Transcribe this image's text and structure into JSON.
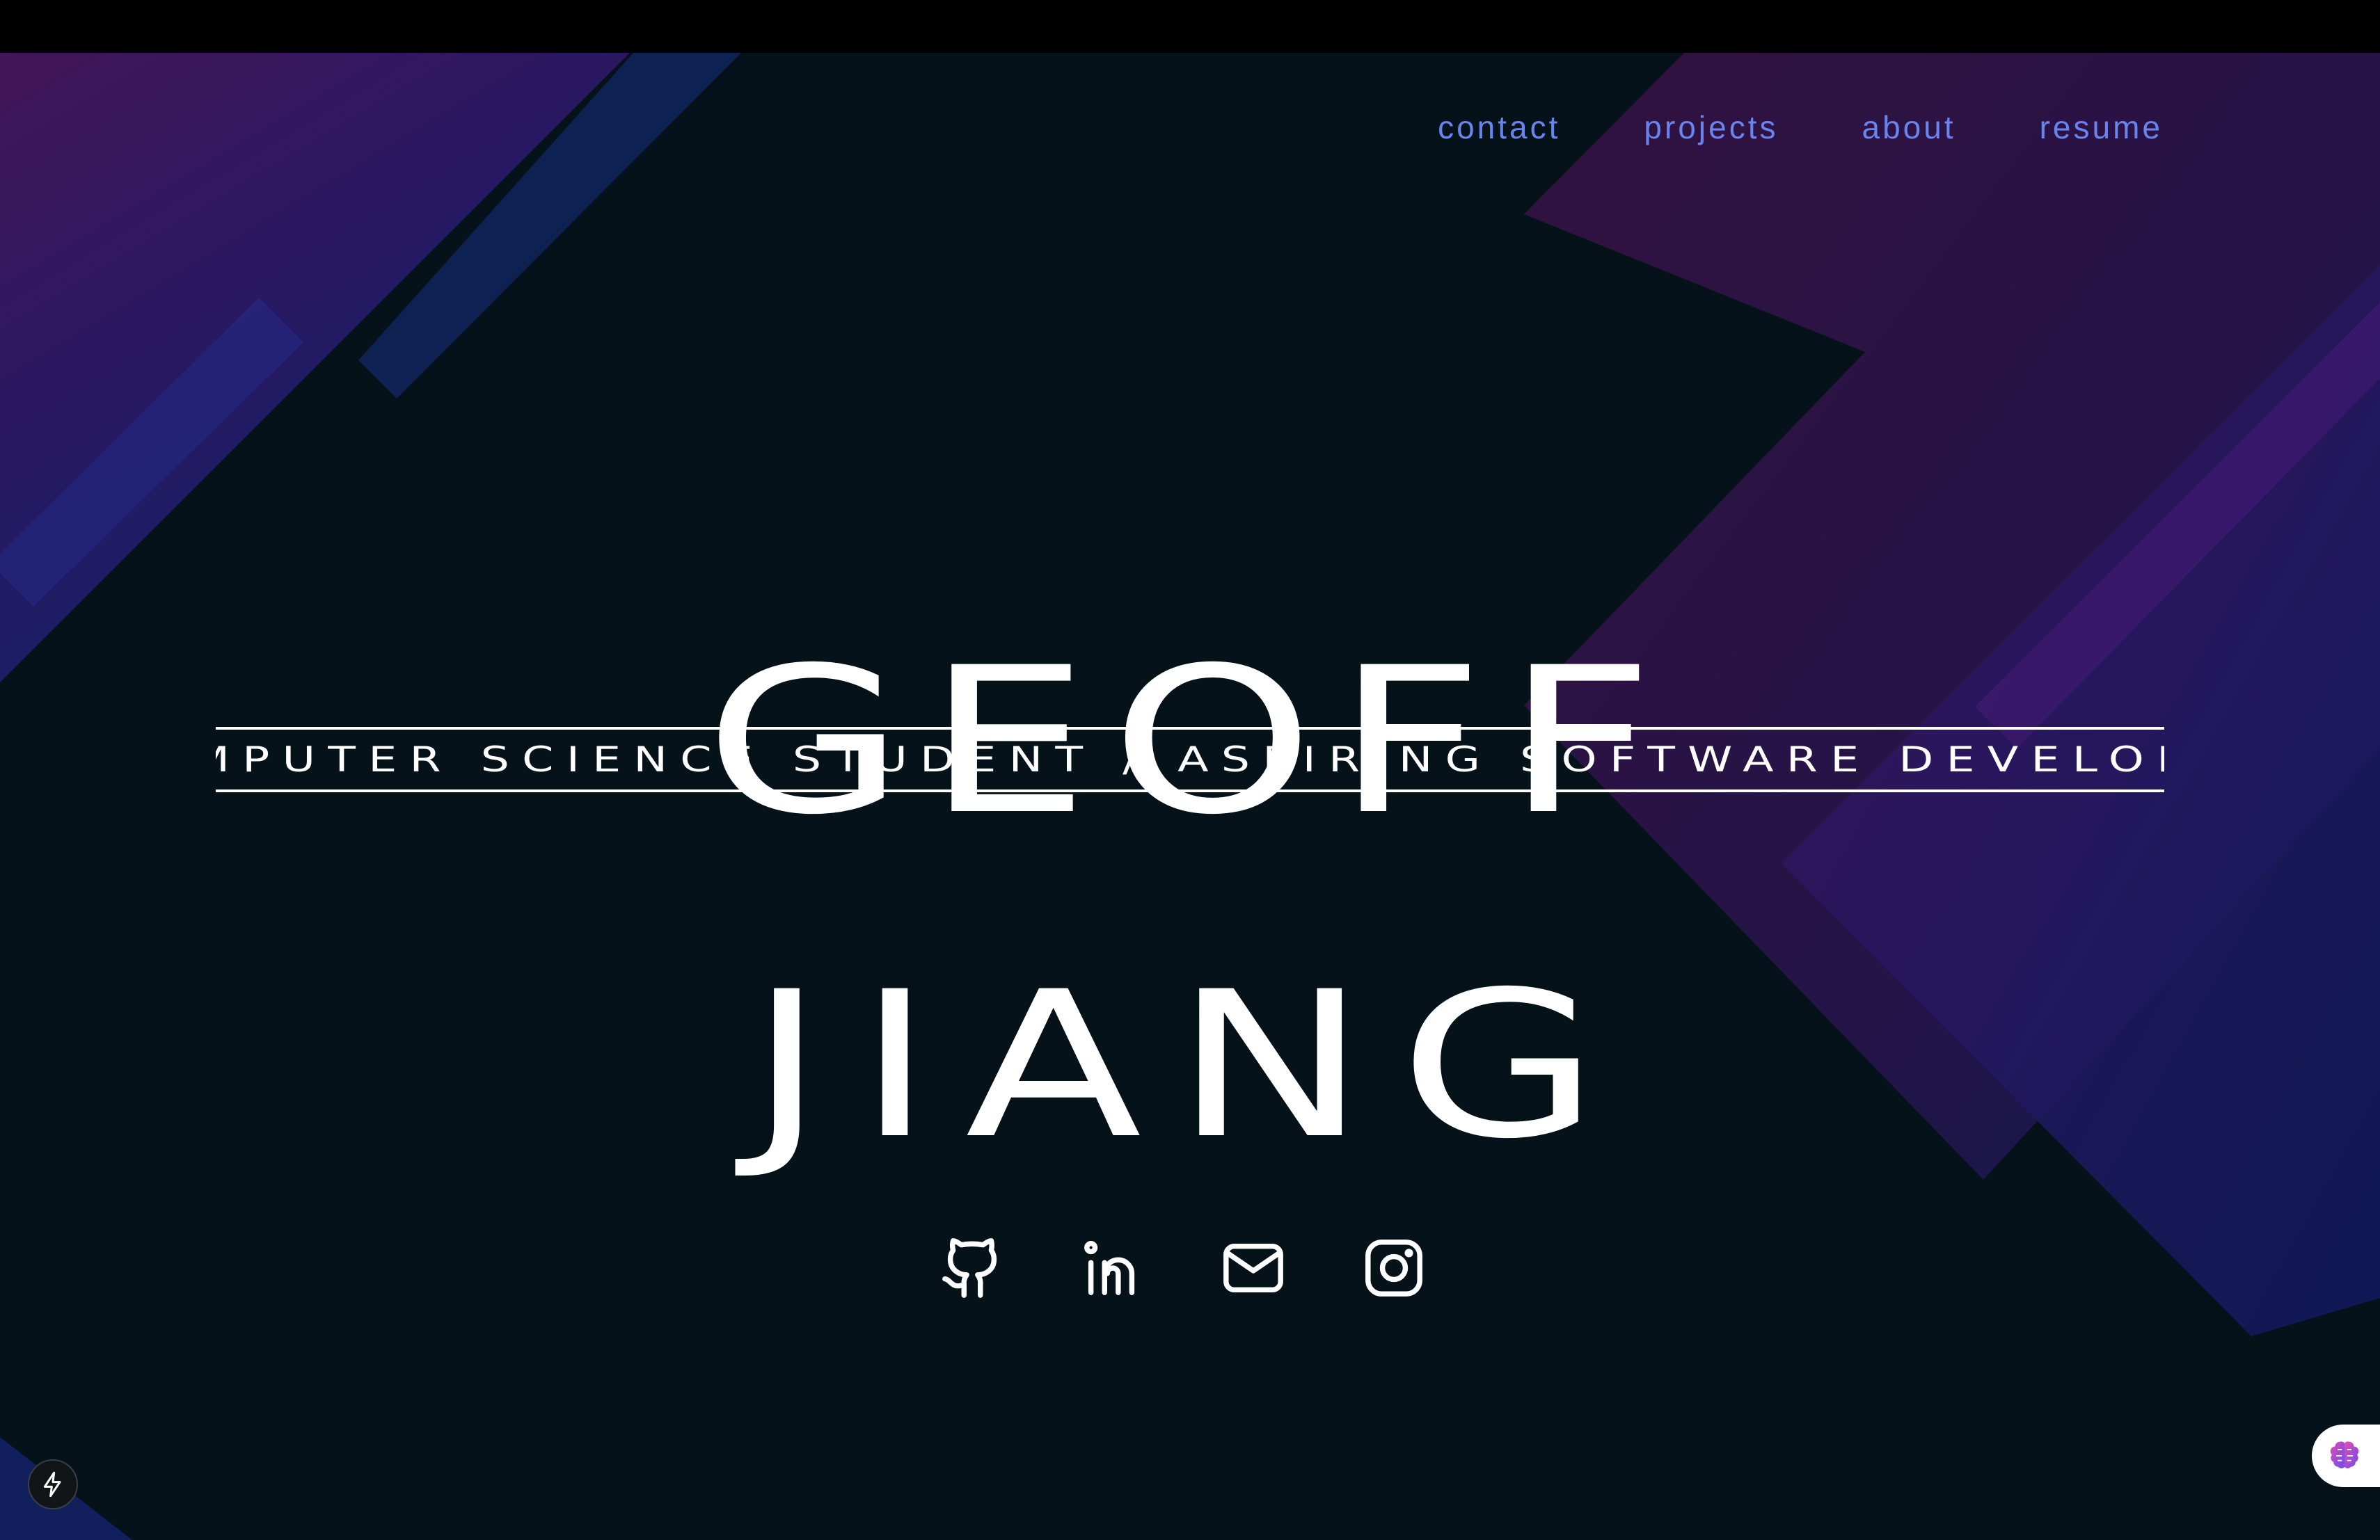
{
  "nav": {
    "items": [
      {
        "label": "contact"
      },
      {
        "label": "projects"
      },
      {
        "label": "about"
      },
      {
        "label": "resume"
      }
    ]
  },
  "hero": {
    "first_name": "GEOFF",
    "subtitle": "COMPUTER SCIENCE STUDENT / ASPIRING SOFTWARE DEVELOPER",
    "last_name": "JIANG"
  },
  "socials": [
    {
      "icon": "github-icon"
    },
    {
      "icon": "linkedin-icon"
    },
    {
      "icon": "mail-icon"
    },
    {
      "icon": "instagram-icon"
    }
  ],
  "widgets": {
    "corner_button_icon": "lightning-icon",
    "side_tab_icon": "brain-icon"
  },
  "colors": {
    "background": "#06121a",
    "nav_link": "#6a84ee",
    "text": "#ffffff",
    "accent_purple": "#4a1a6e",
    "accent_blue": "#1b2a7a"
  }
}
